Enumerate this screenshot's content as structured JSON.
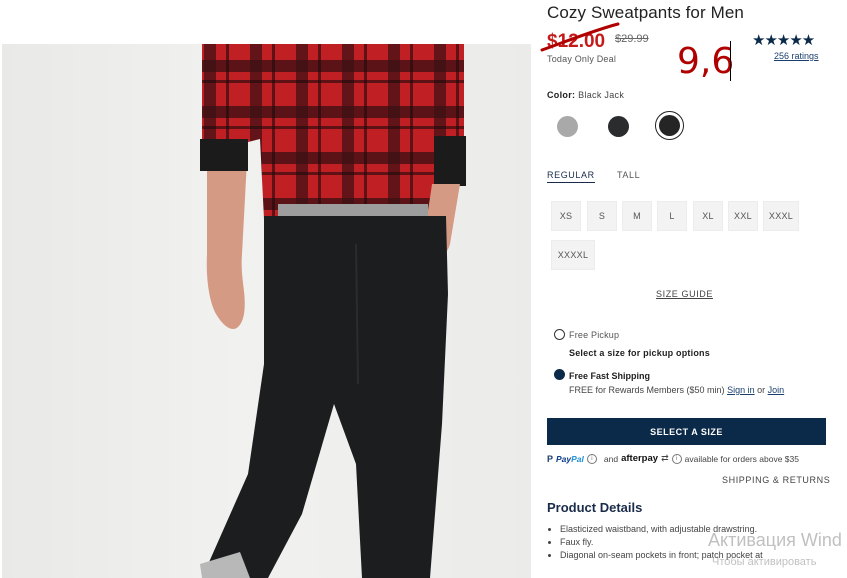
{
  "product": {
    "title": "Cozy Sweatpants for Men",
    "sale_price": "$12.00",
    "original_price": "$29.99",
    "deal_label": "Today Only Deal",
    "rating_stars": "★★★★★",
    "ratings_count": "256 ratings"
  },
  "annotation": {
    "number": "9,6"
  },
  "color": {
    "label": "Color:",
    "selected": "Black Jack",
    "swatches": [
      "#a9a9a9",
      "#2b2c2e",
      "#252526"
    ]
  },
  "fit": {
    "tabs": [
      "REGULAR",
      "TALL"
    ],
    "selected": "REGULAR"
  },
  "sizes": [
    "XS",
    "S",
    "M",
    "L",
    "XL",
    "XXL",
    "XXXL",
    "XXXXL"
  ],
  "size_guide": "SIZE GUIDE",
  "shipping": {
    "pickup_label": "Free Pickup",
    "pickup_sub": "Select a size for pickup options",
    "fast_label": "Free Fast Shipping",
    "fast_sub": "FREE for Rewards Members ($50 min)",
    "sign_in": "Sign in",
    "or": "or",
    "join": "Join"
  },
  "cta": "SELECT A SIZE",
  "payment": {
    "paypal_pay": "Pay",
    "paypal_pal": "Pal",
    "and": "and",
    "afterpay": "afterpay",
    "availability": "available for orders above $35"
  },
  "shipping_returns": "SHIPPING & RETURNS",
  "details": {
    "title": "Product Details",
    "items": [
      "Elasticized waistband, with adjustable drawstring.",
      "Faux fly.",
      "Diagonal on-seam pockets in front; patch pocket at"
    ]
  },
  "watermark": {
    "line1": "Активация Wind",
    "line2": "Чтобы активировать"
  },
  "colors": {
    "sale_red": "#c41a1a",
    "navy": "#0b2a4a",
    "link_blue": "#1a3e6e"
  }
}
